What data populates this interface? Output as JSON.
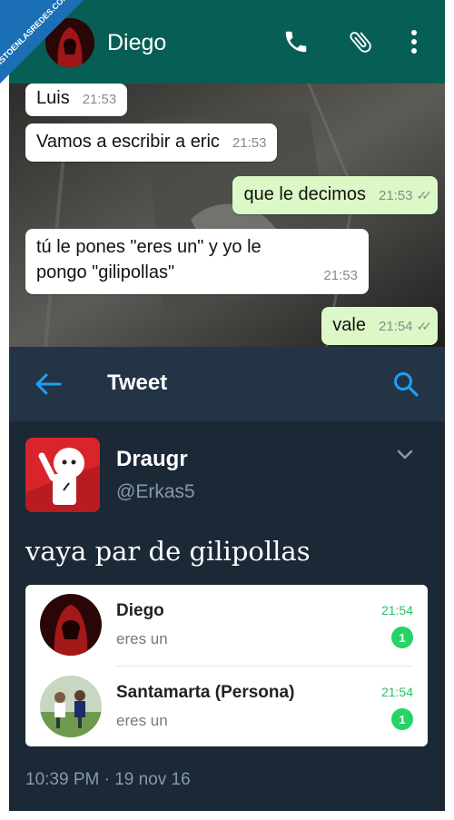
{
  "watermark": {
    "text": "VISTOENLASREDES.COM"
  },
  "whatsapp": {
    "contact_name": "Diego",
    "icons": [
      "arrow-icon",
      "phone-icon",
      "paperclip-icon",
      "more-icon"
    ],
    "header_color": "#075e54",
    "messages": [
      {
        "text": "Luis",
        "time": "21:53",
        "direction": "in"
      },
      {
        "text": "Vamos a escribir a eric",
        "time": "21:53",
        "direction": "in"
      },
      {
        "text": "que le decimos",
        "time": "21:53",
        "direction": "out",
        "ticks": "✓✓"
      },
      {
        "text_line1": "tú le pones \"eres un\" y yo le",
        "text_line2": "pongo \"gilipollas\"",
        "time": "21:53",
        "direction": "in"
      },
      {
        "text": "vale",
        "time": "21:54",
        "direction": "out",
        "ticks": "✓✓"
      }
    ]
  },
  "tweet": {
    "header_title": "Tweet",
    "display_name": "Draugr",
    "handle": "@Erkas5",
    "text": "vaya par de gilipollas",
    "timestamp": "10:39 PM · 19 nov 16",
    "accent_color": "#1da1f2",
    "chats": [
      {
        "name": "Diego",
        "message": "eres un",
        "time": "21:54",
        "unread": "1"
      },
      {
        "name": "Santamarta (Persona)",
        "message": "eres un",
        "time": "21:54",
        "unread": "1"
      }
    ]
  }
}
